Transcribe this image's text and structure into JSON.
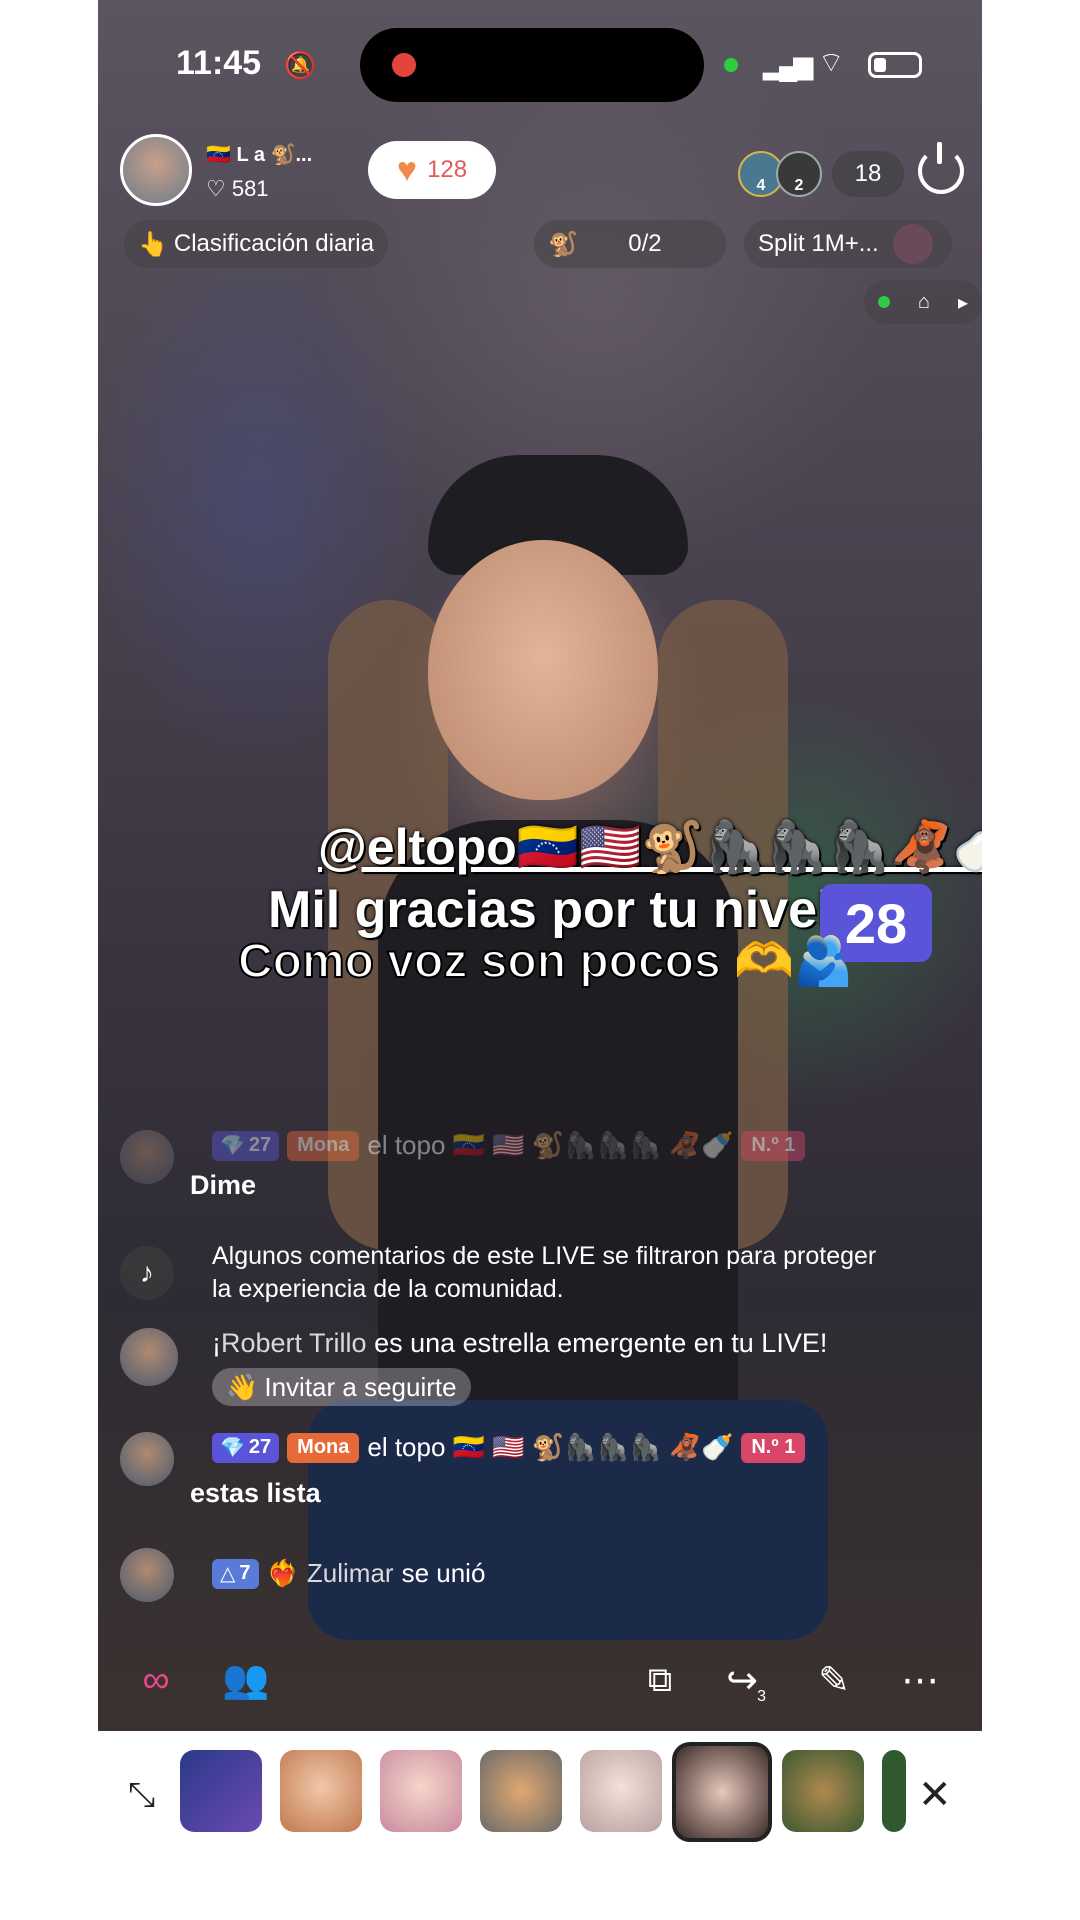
{
  "status": {
    "time": "11:45"
  },
  "host": {
    "name": "🇻🇪 L a 🐒...",
    "likes": "♡ 581",
    "like_count": "128"
  },
  "viewers": {
    "badge_a": "4",
    "badge_b": "2",
    "count": "18"
  },
  "badges": {
    "daily": "Clasificación diaria",
    "match": "0/2",
    "split": "Split 1M+..."
  },
  "overlay": {
    "user": "@eltopo🇻🇪🇺🇸🐒🦍🦍🦍🦧🍼",
    "thanks": "Mil gracias por tu nivel",
    "level": "28",
    "sub": "Como voz son pocos 🫶🫂"
  },
  "chat": [
    {
      "level": "27",
      "fan": "Mona",
      "user": "el topo 🇻🇪 🇺🇸 🐒🦍🦍🦍 🦧🍼",
      "rank": "N.º 1",
      "message": "Dime"
    },
    {
      "system": "Algunos comentarios de este LIVE se filtraron para proteger la experiencia de la comunidad."
    },
    {
      "name": "Robert Trillo",
      "text": "es una estrella emergente en tu LIVE!",
      "prefix": "¡",
      "action": "Invitar a seguirte"
    },
    {
      "level": "27",
      "fan": "Mona",
      "user": "el topo 🇻🇪 🇺🇸 🐒🦍🦍🦍 🦧🍼",
      "rank": "N.º 1",
      "message": "estas lista"
    },
    {
      "level": "7",
      "user": "Zulimar",
      "text": "se unió"
    }
  ],
  "toolbar": {
    "share_count": "3"
  },
  "colors": {
    "accent": "#5a55d8",
    "like": "#e15a5a",
    "fan_badge": "#e66a38",
    "rank_badge": "#d8466a"
  },
  "icons": [
    "bell-slash-icon",
    "signal-icon",
    "wifi-icon",
    "battery-icon",
    "power-icon",
    "heart-icon",
    "fire-icon",
    "expand-icon",
    "close-icon",
    "link-icon",
    "people-icon",
    "share-icon",
    "pencil-icon",
    "more-icon",
    "comment-icon"
  ]
}
